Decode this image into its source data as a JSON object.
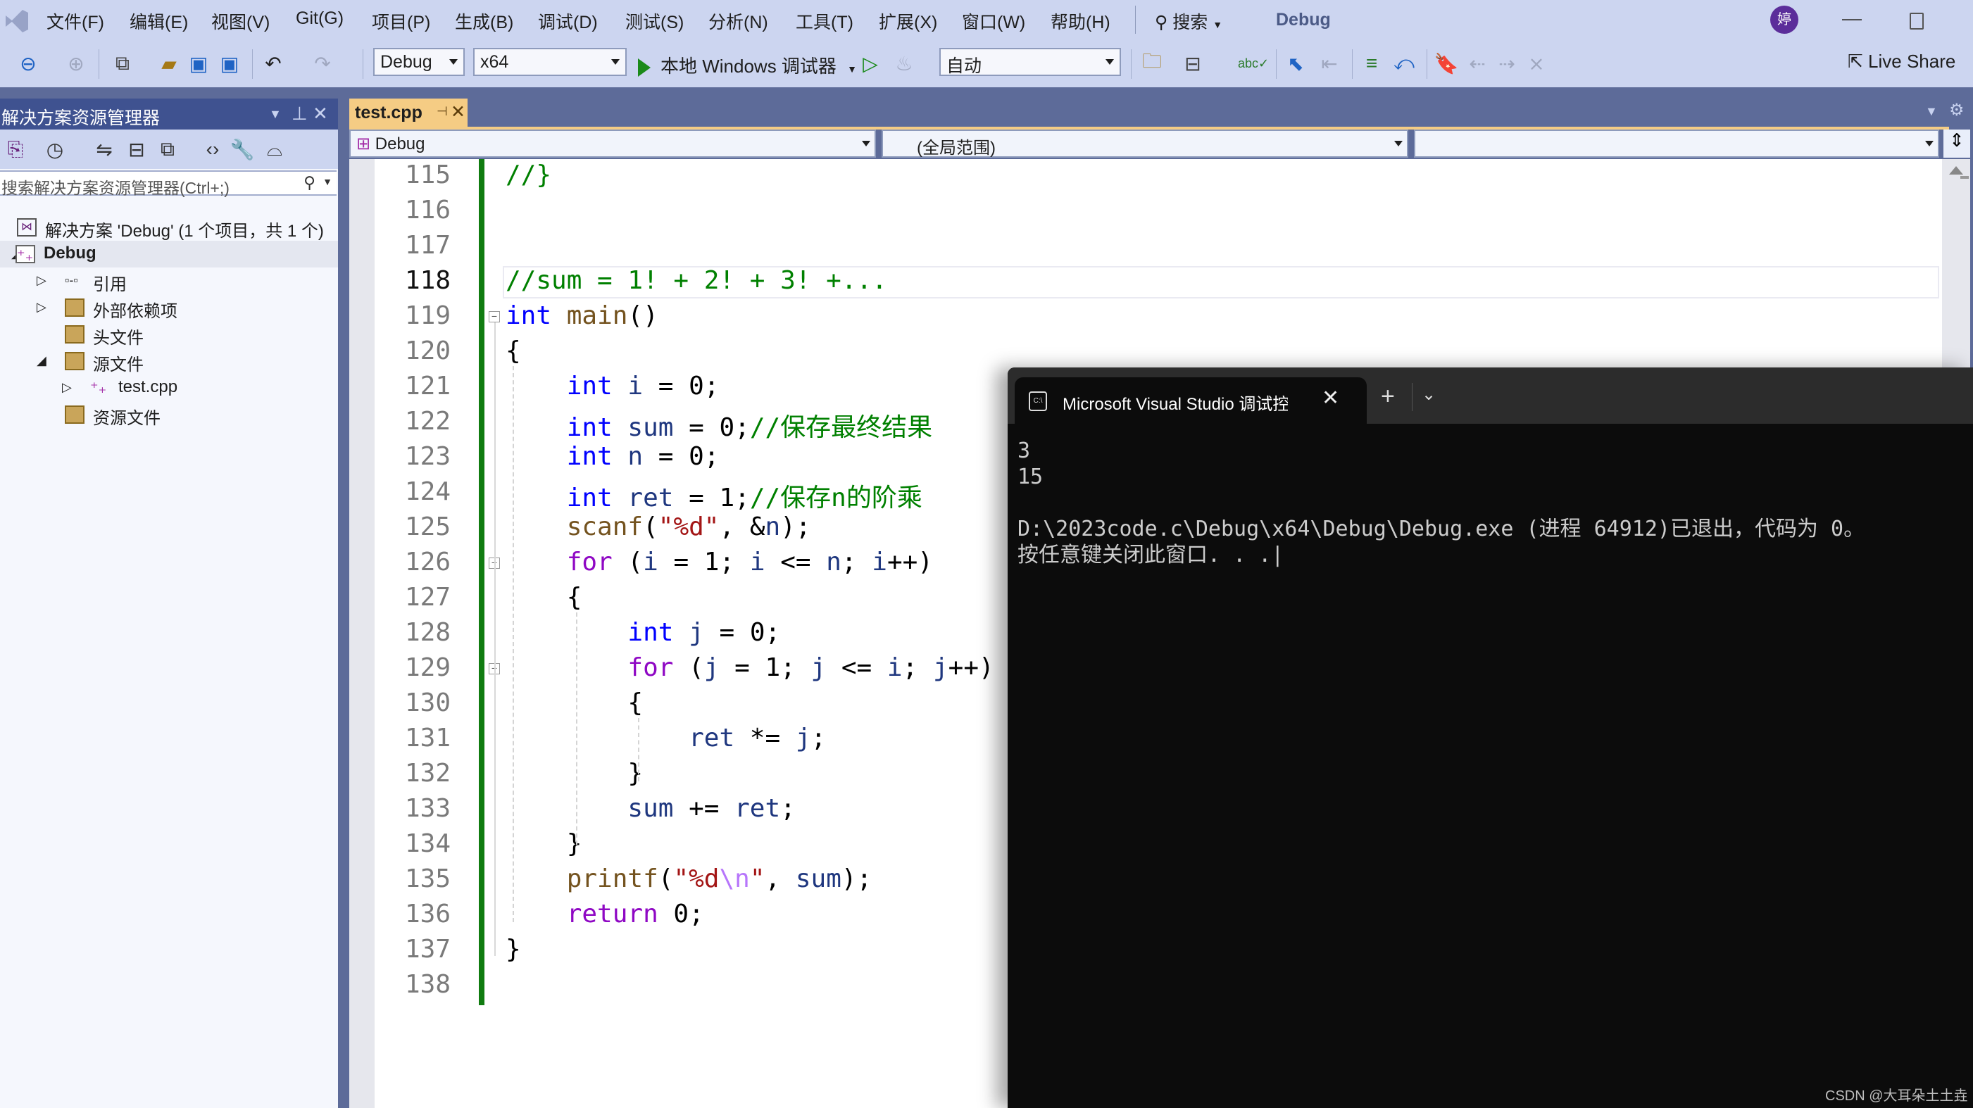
{
  "menubar": {
    "items": [
      "文件(F)",
      "编辑(E)",
      "视图(V)",
      "Git(G)",
      "项目(P)",
      "生成(B)",
      "调试(D)",
      "测试(S)",
      "分析(N)",
      "工具(T)",
      "扩展(X)",
      "窗口(W)",
      "帮助(H)"
    ],
    "search_label": "搜索",
    "solution_name": "Debug",
    "avatar_initial": "婷"
  },
  "toolbar": {
    "config": "Debug",
    "platform": "x64",
    "run_label": "本地 Windows 调试器",
    "mode": "自动",
    "live_share": "Live Share"
  },
  "solution_explorer": {
    "title": "解决方案资源管理器",
    "search_placeholder": "搜索解决方案资源管理器(Ctrl+;)",
    "tree": [
      {
        "label": "解决方案 'Debug' (1 个项目，共 1 个)",
        "icon": "solution-icon",
        "expander": ""
      },
      {
        "label": "Debug",
        "icon": "cpp-project-icon",
        "expander": "◢",
        "selected": true
      },
      {
        "label": "引用",
        "icon": "references-icon",
        "expander": "▷"
      },
      {
        "label": "外部依赖项",
        "icon": "external-deps-icon",
        "expander": "▷"
      },
      {
        "label": "头文件",
        "icon": "filter-folder-icon",
        "expander": ""
      },
      {
        "label": "源文件",
        "icon": "filter-folder-icon",
        "expander": "◢"
      },
      {
        "label": "test.cpp",
        "icon": "cpp-file-icon",
        "expander": "▷"
      },
      {
        "label": "资源文件",
        "icon": "filter-folder-icon",
        "expander": ""
      }
    ]
  },
  "editor": {
    "tab_label": "test.cpp",
    "nav_project": "Debug",
    "nav_scope": "(全局范围)",
    "nav_member": "",
    "current_line": 118,
    "lines": [
      {
        "n": "115",
        "html": "<span class=\"cm\">//}</span>"
      },
      {
        "n": "116",
        "html": ""
      },
      {
        "n": "117",
        "html": ""
      },
      {
        "n": "118",
        "html": "<span class=\"cm\">//sum = 1! + 2! + 3! +...</span>"
      },
      {
        "n": "119",
        "html": "<span class=\"kw\">int</span> <span class=\"fn\">main</span>()"
      },
      {
        "n": "120",
        "html": "{"
      },
      {
        "n": "121",
        "html": "    <span class=\"kw\">int</span> <span class=\"var\">i</span> = 0;"
      },
      {
        "n": "122",
        "html": "    <span class=\"kw\">int</span> <span class=\"var\">sum</span> = 0;<span class=\"cm\">//保存最终结果</span>"
      },
      {
        "n": "123",
        "html": "    <span class=\"kw\">int</span> <span class=\"var\">n</span> = 0;"
      },
      {
        "n": "124",
        "html": "    <span class=\"kw\">int</span> <span class=\"var\">ret</span> = 1;<span class=\"cm\">//保存n的阶乘</span>"
      },
      {
        "n": "125",
        "html": "    <span class=\"fn\">scanf</span>(<span class=\"str\">\"%d\"</span>, &amp;<span class=\"var\">n</span>);"
      },
      {
        "n": "126",
        "html": "    <span class=\"ctl\">for</span> (<span class=\"var\">i</span> = 1; <span class=\"var\">i</span> &lt;= <span class=\"var\">n</span>; <span class=\"var\">i</span>++)"
      },
      {
        "n": "127",
        "html": "    {"
      },
      {
        "n": "128",
        "html": "        <span class=\"kw\">int</span> <span class=\"var\">j</span> = 0;"
      },
      {
        "n": "129",
        "html": "        <span class=\"ctl\">for</span> (<span class=\"var\">j</span> = 1; <span class=\"var\">j</span> &lt;= <span class=\"var\">i</span>; <span class=\"var\">j</span>++)"
      },
      {
        "n": "130",
        "html": "        {"
      },
      {
        "n": "131",
        "html": "            <span class=\"var\">ret</span> *= <span class=\"var\">j</span>;"
      },
      {
        "n": "132",
        "html": "        }"
      },
      {
        "n": "133",
        "html": "        <span class=\"var\">sum</span> += <span class=\"var\">ret</span>;"
      },
      {
        "n": "134",
        "html": "    }"
      },
      {
        "n": "135",
        "html": "    <span class=\"fn\">printf</span>(<span class=\"str\">\"%d</span><span class=\"esc\">\\n</span><span class=\"str\">\"</span>, <span class=\"var\">sum</span>);"
      },
      {
        "n": "136",
        "html": "    <span class=\"ctl\">return</span> 0;"
      },
      {
        "n": "137",
        "html": "}"
      },
      {
        "n": "138",
        "html": ""
      }
    ]
  },
  "console": {
    "tab_title": "Microsoft Visual Studio 调试控制台",
    "output": "3\n15\n\nD:\\2023code.c\\Debug\\x64\\Debug\\Debug.exe (进程 64912)已退出，代码为 0。\n按任意键关闭此窗口. . .|"
  },
  "watermark": "CSDN @大耳朵土土垚",
  "colors": {
    "menubar_bg": "#ccd5f0",
    "panel_header_bg": "#3f5290",
    "active_tab_bg": "#f5cc84",
    "change_bar": "#107c10",
    "keyword": "#0000ff",
    "control_keyword": "#8f08c4",
    "function": "#74531f",
    "variable": "#1f377f",
    "string": "#a31515",
    "comment": "#008000",
    "console_bg": "#0c0c0c"
  }
}
